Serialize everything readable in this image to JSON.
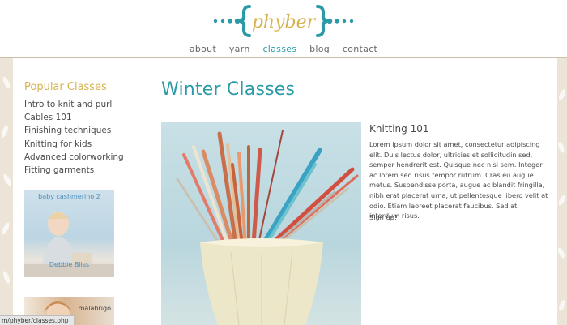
{
  "brand": {
    "logo_text": "phyber",
    "accent": "#2a9aa6",
    "gold": "#d6b34f"
  },
  "nav": [
    {
      "label": "about",
      "active": false
    },
    {
      "label": "yarn",
      "active": false
    },
    {
      "label": "classes",
      "active": true
    },
    {
      "label": "blog",
      "active": false
    },
    {
      "label": "contact",
      "active": false
    }
  ],
  "sidebar": {
    "title": "Popular Classes",
    "items": [
      "Intro to knit and purl",
      "Cables 101",
      "Finishing techniques",
      "Knitting for kids",
      "Advanced colorworking",
      "Fitting garments"
    ],
    "thumbs": [
      {
        "caption": "baby cashmerino 2",
        "caption2": "Debbie Bliss"
      },
      {
        "caption": "malabrigo"
      }
    ]
  },
  "main": {
    "title": "Winter Classes",
    "class": {
      "title": "Knitting 101",
      "description": "Lorem ipsum dolor sit amet, consectetur adipiscing elit. Duis lectus dolor, ultricies et sollicitudin sed, semper hendrerit est. Quisque nec nisi sem. Integer ac lorem sed risus tempor rutrum. Cras eu augue metus. Suspendisse porta, augue ac blandit fringilla, nibh erat placerat urna, ut pellentesque libero velit at odio. Etiam laoreet placerat faucibus. Sed at interdum risus.",
      "signup": "Sign up!"
    }
  },
  "status_bar": {
    "url": "m/phyber/classes.php"
  }
}
